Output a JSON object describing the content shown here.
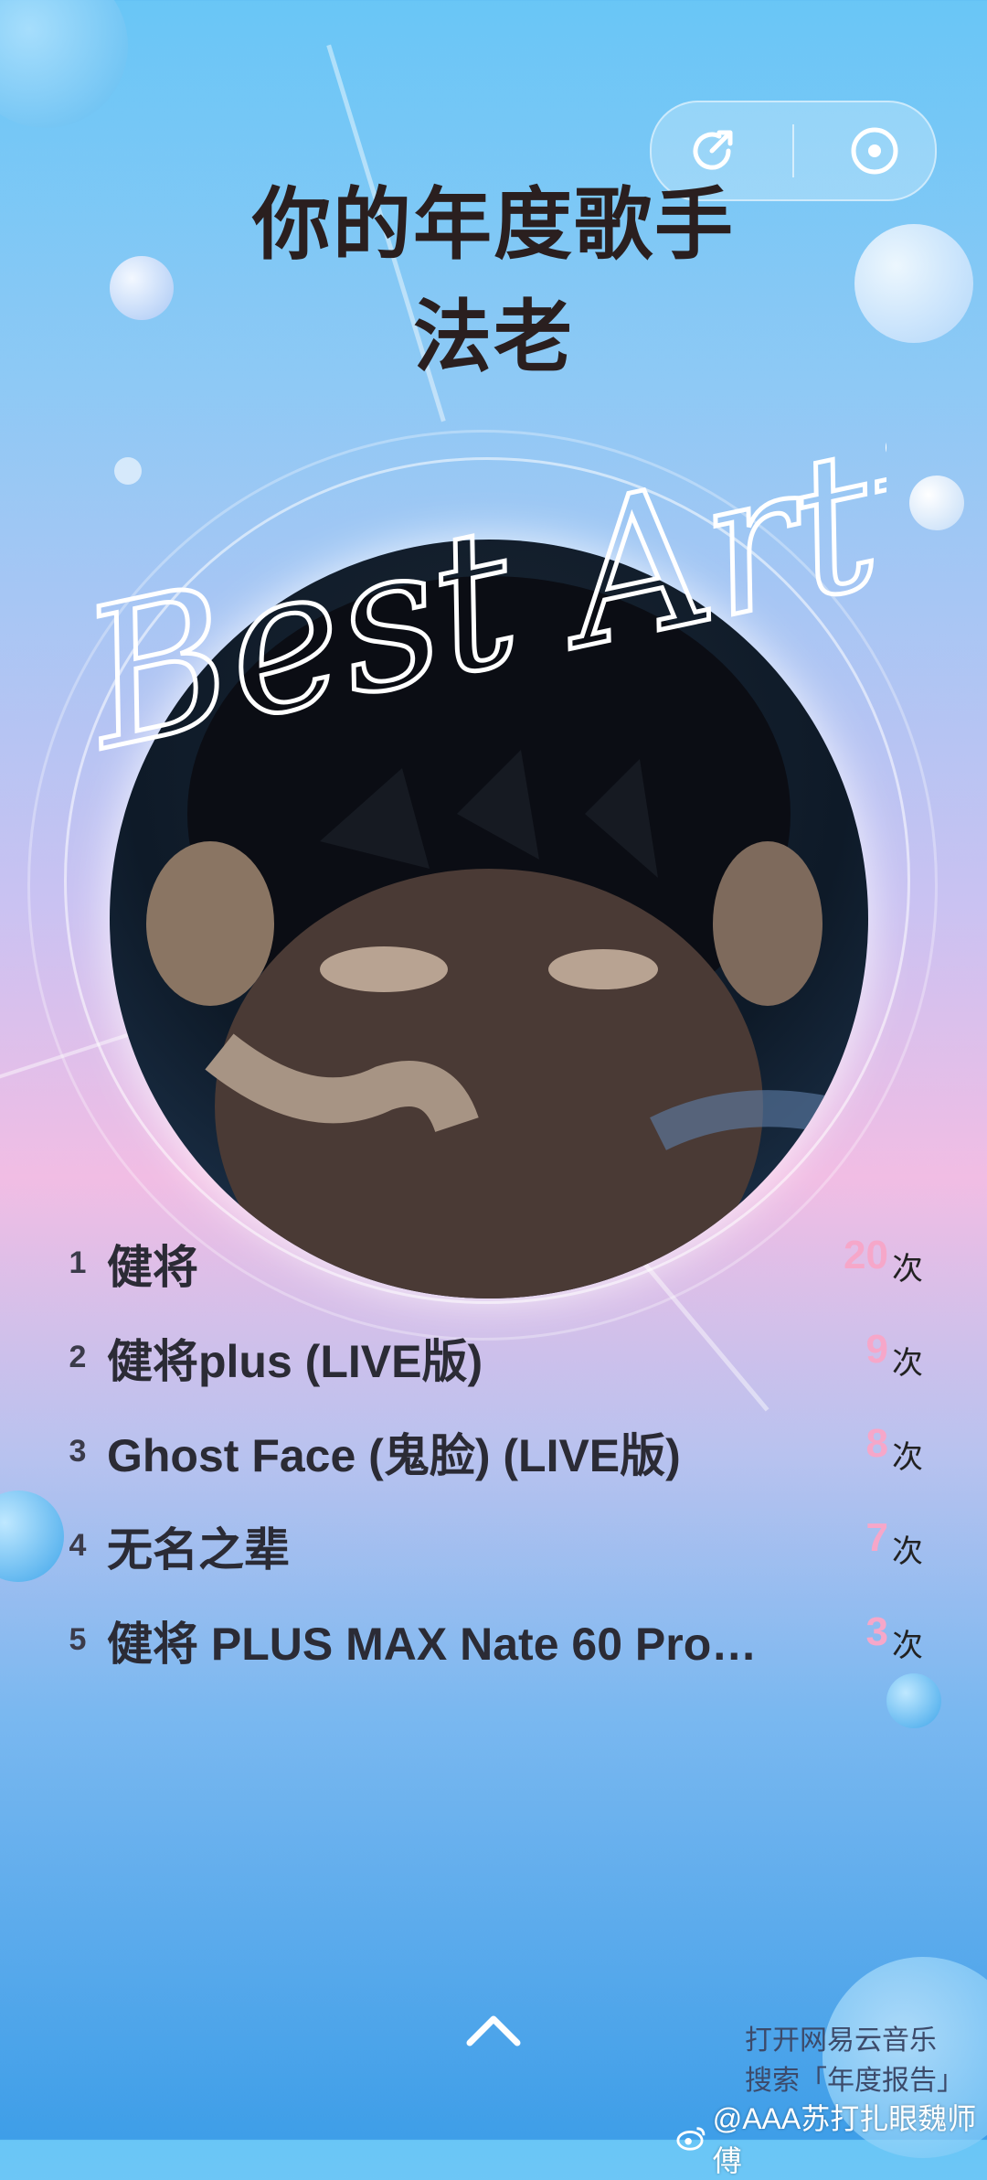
{
  "header": {
    "title_line1": "你的年度歌手",
    "title_line2": "法老"
  },
  "toolbar": {
    "share_icon": "share-icon",
    "record_icon": "record-icon"
  },
  "decor": {
    "cursive_text": "Best Artist"
  },
  "ranking": {
    "items": [
      {
        "rank": "1",
        "song": "健将",
        "count": "20",
        "unit": "次"
      },
      {
        "rank": "2",
        "song": "健将plus (LIVE版)",
        "count": "9",
        "unit": "次"
      },
      {
        "rank": "3",
        "song": "Ghost Face (鬼脸) (LIVE版)",
        "count": "8",
        "unit": "次"
      },
      {
        "rank": "4",
        "song": "无名之辈",
        "count": "7",
        "unit": "次"
      },
      {
        "rank": "5",
        "song": "健将 PLUS MAX Nate 60 Pro…",
        "count": "3",
        "unit": "次"
      }
    ]
  },
  "footer": {
    "promo_line1": "打开网易云音乐",
    "promo_line2": "搜索「年度报告」",
    "watermark": "@AAA苏打扎眼魏师傅"
  },
  "colors": {
    "count_pink": "#f6a7c9",
    "title_dark": "#2a1f1f"
  }
}
